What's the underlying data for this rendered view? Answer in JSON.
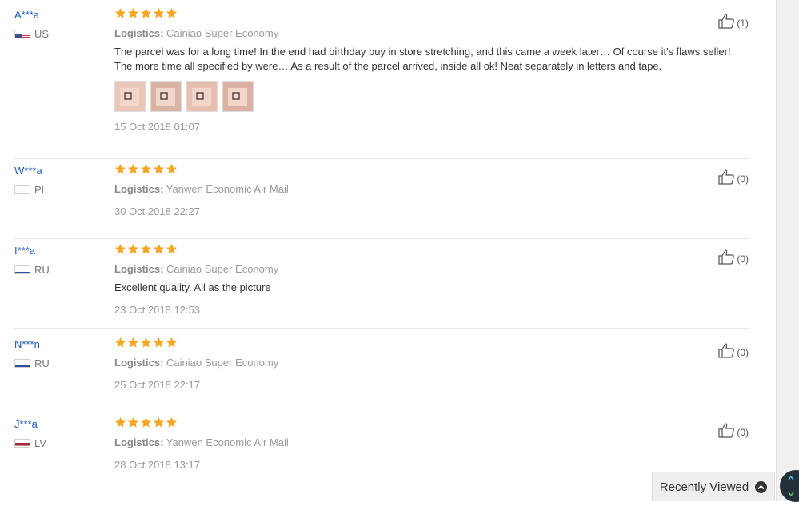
{
  "labels": {
    "logistics": "Logistics:"
  },
  "colors": {
    "star": "#f5a623",
    "buyer_name": "#1a5bb5"
  },
  "reviews": [
    {
      "buyer": "A***a",
      "country": "US",
      "flag": "us-flag-icon",
      "rating": 5,
      "logistics": "Cainiao Super Economy",
      "text": "The parcel was for a long time! In the end had birthday buy in store stretching, and this came a week later… Of course it's flaws seller! The more time all specified by were… As a result of the parcel arrived, inside all ok! Neat separately in letters and tape.",
      "photos": 4,
      "date": "15 Oct 2018 01:07",
      "helpful": "(1)"
    },
    {
      "buyer": "W***a",
      "country": "PL",
      "flag": "pl-flag-icon",
      "rating": 5,
      "logistics": "Yanwen Economic Air Mail",
      "text": "",
      "photos": 0,
      "date": "30 Oct 2018 22:27",
      "helpful": "(0)"
    },
    {
      "buyer": "I***a",
      "country": "RU",
      "flag": "ru-flag-icon",
      "rating": 5,
      "logistics": "Cainiao Super Economy",
      "text": "Excellent quality. All as the picture",
      "photos": 0,
      "date": "23 Oct 2018 12:53",
      "helpful": "(0)"
    },
    {
      "buyer": "N***n",
      "country": "RU",
      "flag": "ru-flag-icon",
      "rating": 5,
      "logistics": "Cainiao Super Economy",
      "text": "",
      "photos": 0,
      "date": "25 Oct 2018 22:17",
      "helpful": "(0)"
    },
    {
      "buyer": "J***a",
      "country": "LV",
      "flag": "lv-flag-icon",
      "rating": 5,
      "logistics": "Yanwen Economic Air Mail",
      "text": "",
      "photos": 0,
      "date": "28 Oct 2018 13:17",
      "helpful": "(0)"
    }
  ],
  "recently_viewed": {
    "label": "Recently Viewed",
    "icon": "chevron-up-icon"
  },
  "floating_button": {
    "icon": "scroll-arrows-icon"
  }
}
